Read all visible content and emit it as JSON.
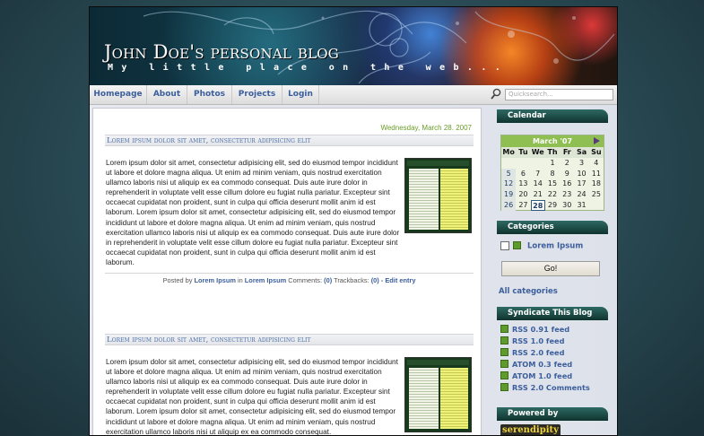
{
  "header": {
    "title": "John Doe's personal blog",
    "tagline": "My little place on the web..."
  },
  "nav": {
    "items": [
      "Homepage",
      "About",
      "Photos",
      "Projects",
      "Login"
    ],
    "search_placeholder": "Quicksearch..."
  },
  "entries": [
    {
      "date": "Wednesday, March 28. 2007",
      "title": "Lorem ipsum dolor sit amet, consectetur adipisicing elit",
      "body": "Lorem ipsum dolor sit amet, consectetur adipisicing elit, sed do eiusmod tempor incididunt ut labore et dolore magna aliqua. Ut enim ad minim veniam, quis nostrud exercitation ullamco laboris nisi ut aliquip ex ea commodo consequat. Duis aute irure dolor in reprehenderit in voluptate velit esse cillum dolore eu fugiat nulla pariatur. Excepteur sint occaecat cupidatat non proident, sunt in culpa qui officia deserunt mollit anim id est laborum. Lorem ipsum dolor sit amet, consectetur adipisicing elit, sed do eiusmod tempor incididunt ut labore et dolore magna aliqua. Ut enim ad minim veniam, quis nostrud exercitation ullamco laboris nisi ut aliquip ex ea commodo consequat. Duis aute irure dolor in reprehenderit in voluptate velit esse cillum dolore eu fugiat nulla pariatur. Excepteur sint occaecat cupidatat non proident, sunt in culpa qui officia deserunt mollit anim id est laborum.",
      "footer": {
        "posted_by_label": "Posted by",
        "author": "Lorem Ipsum",
        "in_label": "in",
        "category": "Lorem Ipsum",
        "comments_label": "Comments:",
        "comments": "(0)",
        "trackbacks_label": "Trackbacks:",
        "trackbacks": "(0)",
        "edit": "- Edit entry"
      }
    },
    {
      "title": "Lorem ipsum dolor sit amet, consectetur adipisicing elit",
      "body": "Lorem ipsum dolor sit amet, consectetur adipisicing elit, sed do eiusmod tempor incididunt ut labore et dolore magna aliqua. Ut enim ad minim veniam, quis nostrud exercitation ullamco laboris nisi ut aliquip ex ea commodo consequat. Duis aute irure dolor in reprehenderit in voluptate velit esse cillum dolore eu fugiat nulla pariatur. Excepteur sint occaecat cupidatat non proident, sunt in culpa qui officia deserunt mollit anim id est laborum. Lorem ipsum dolor sit amet, consectetur adipisicing elit, sed do eiusmod tempor incididunt ut labore et dolore magna aliqua. Ut enim ad minim veniam, quis nostrud exercitation ullamco laboris nisi ut aliquip ex ea commodo consequat."
    }
  ],
  "sidebar": {
    "calendar": {
      "title": "Calendar",
      "month": "March '07",
      "days": [
        "Mo",
        "Tu",
        "We",
        "Th",
        "Fr",
        "Sa",
        "Su"
      ],
      "weeks": [
        [
          "",
          "",
          "",
          "1",
          "2",
          "3",
          "4"
        ],
        [
          "5",
          "6",
          "7",
          "8",
          "9",
          "10",
          "11"
        ],
        [
          "12",
          "13",
          "14",
          "15",
          "16",
          "17",
          "18"
        ],
        [
          "19",
          "20",
          "21",
          "22",
          "23",
          "24",
          "25"
        ],
        [
          "26",
          "27",
          "28",
          "29",
          "30",
          "31",
          ""
        ]
      ],
      "entry_days": [
        "5",
        "12",
        "19",
        "26"
      ],
      "today": "28"
    },
    "categories": {
      "title": "Categories",
      "items": [
        "Lorem Ipsum"
      ],
      "go_label": "Go!",
      "all_label": "All categories"
    },
    "syndicate": {
      "title": "Syndicate This Blog",
      "feeds": [
        "RSS 0.91 feed",
        "RSS 1.0 feed",
        "RSS 2.0 feed",
        "ATOM 0.3 feed",
        "ATOM 1.0 feed",
        "RSS 2.0 Comments"
      ]
    },
    "powered": {
      "title": "Powered by",
      "logo": "serendipity"
    }
  },
  "colors": {
    "link": "#3c5f9c",
    "date": "#6a9d2a",
    "sidebar_header": "#1f4d48",
    "calendar_header": "#8fbf52"
  }
}
